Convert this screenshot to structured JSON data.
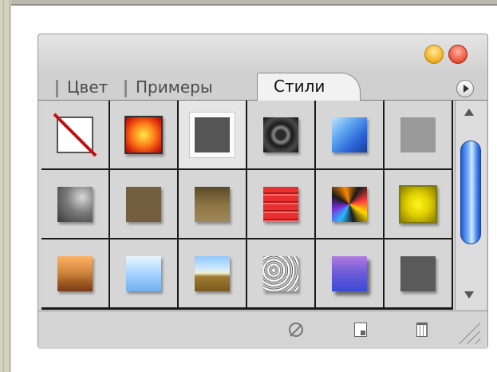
{
  "panel": {
    "tabs": [
      {
        "label": "Цвет",
        "active": false
      },
      {
        "label": "Примеры",
        "active": false
      },
      {
        "label": "Стили",
        "active": true
      }
    ],
    "menu_icon": "play-arrow-circle-icon",
    "window_buttons": [
      "minimize-button",
      "close-button"
    ],
    "styles": [
      {
        "name": "none-style",
        "icon": "no-style-icon"
      },
      {
        "name": "orange-glow",
        "colors": [
          "#ffea45",
          "#ff5a10",
          "#9a0a0a"
        ]
      },
      {
        "name": "gray-white-border",
        "colors": [
          "#555555",
          "#ffffff"
        ]
      },
      {
        "name": "dark-metal-ring",
        "colors": [
          "#9a9a9a",
          "#1a1a1a"
        ]
      },
      {
        "name": "blue-sky",
        "colors": [
          "#2b63d6",
          "#9fd0ff",
          "#1b3f99"
        ]
      },
      {
        "name": "gray-flat",
        "colors": [
          "#9a9a9a",
          "#8a8a8a"
        ]
      },
      {
        "name": "smoke-gray",
        "colors": [
          "#d8d8d8",
          "#3a3a3a"
        ]
      },
      {
        "name": "brown-flat",
        "colors": [
          "#7a6a4a",
          "#665535"
        ]
      },
      {
        "name": "bronze",
        "colors": [
          "#8c7342",
          "#4a3a1a"
        ]
      },
      {
        "name": "red-stripes",
        "colors": [
          "#e83030",
          "#a01010"
        ]
      },
      {
        "name": "rainbow-swirl",
        "colors": [
          "#1a1a1a",
          "#ff3a3a",
          "#ffd800",
          "#2bb8ff",
          "#7a2bd6"
        ]
      },
      {
        "name": "yellow-gold",
        "colors": [
          "#7a7a10",
          "#fff520",
          "#8a7a00"
        ]
      },
      {
        "name": "sunset",
        "colors": [
          "#ffb060",
          "#c07a30",
          "#7a3a1a"
        ]
      },
      {
        "name": "light-blue-gradient",
        "colors": [
          "#d8efff",
          "#6fb0f0"
        ]
      },
      {
        "name": "landscape",
        "colors": [
          "#8fc8ff",
          "#f0f0d0",
          "#7a5a20"
        ]
      },
      {
        "name": "granite",
        "colors": [
          "#ffffff",
          "#707070"
        ]
      },
      {
        "name": "purple-blue",
        "colors": [
          "#9a5ad0",
          "#3a4ad6"
        ]
      },
      {
        "name": "dark-gray",
        "colors": [
          "#606060",
          "#505050"
        ]
      }
    ],
    "scrollbar": {
      "up_icon": "arrow-up-icon",
      "down_icon": "arrow-down-icon"
    },
    "bottom_icons": [
      "unlink-style-icon",
      "new-style-icon",
      "trash-icon",
      "resize-grip-icon"
    ]
  }
}
